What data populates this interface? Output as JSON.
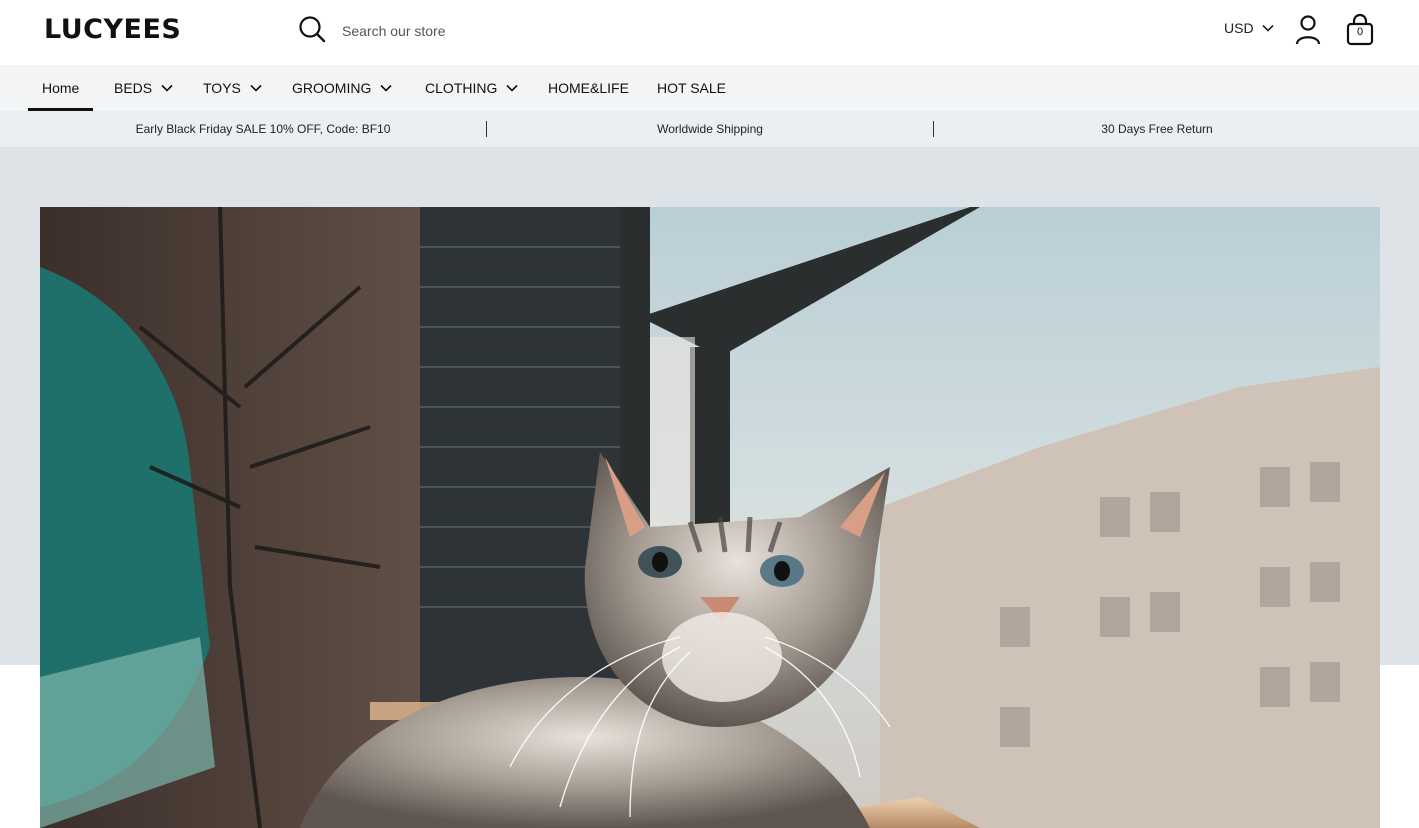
{
  "header": {
    "logo": "LUCYEES",
    "search_placeholder": "Search our store",
    "currency": "USD",
    "cart_count": "0",
    "icons": {
      "search": "search-icon",
      "account": "user-icon",
      "cart": "shopping-bag-icon"
    }
  },
  "nav": {
    "items": [
      {
        "label": "Home",
        "active": true,
        "dropdown": false
      },
      {
        "label": "BEDS",
        "active": false,
        "dropdown": true
      },
      {
        "label": "TOYS",
        "active": false,
        "dropdown": true
      },
      {
        "label": "GROOMING",
        "active": false,
        "dropdown": true
      },
      {
        "label": "CLOTHING",
        "active": false,
        "dropdown": true
      },
      {
        "label": "HOME&LIFE",
        "active": false,
        "dropdown": false
      },
      {
        "label": "HOT SALE",
        "active": false,
        "dropdown": false
      }
    ]
  },
  "announcements": [
    "Early Black Friday SALE 10% OFF, Code: BF10",
    "Worldwide Shipping",
    "30 Days Free Return"
  ],
  "hero": {
    "image": "cat-sitting-by-window-photo"
  },
  "colors": {
    "header_bg": "#ffffff",
    "nav_bg": "#f3f4f6",
    "announce_bg": "#eaeff1",
    "hero_band_bg": "#dde3e6",
    "text": "#111111"
  }
}
